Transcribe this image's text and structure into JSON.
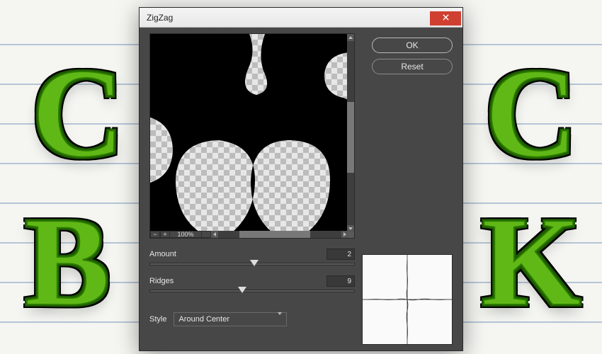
{
  "backdrop_letters": {
    "c1": "C",
    "c2": "C",
    "b": "B",
    "k": "K"
  },
  "dialog": {
    "title": "ZigZag",
    "buttons": {
      "ok": "OK",
      "reset": "Reset"
    },
    "zoom": {
      "value": "100%",
      "minus": "⊟",
      "plus": "⊞"
    },
    "amount": {
      "label": "Amount",
      "value": "2",
      "min": -100,
      "max": 100,
      "pos_pct": 51
    },
    "ridges": {
      "label": "Ridges",
      "value": "9",
      "min": 0,
      "max": 20,
      "pos_pct": 45
    },
    "style": {
      "label": "Style",
      "selected": "Around Center"
    }
  }
}
